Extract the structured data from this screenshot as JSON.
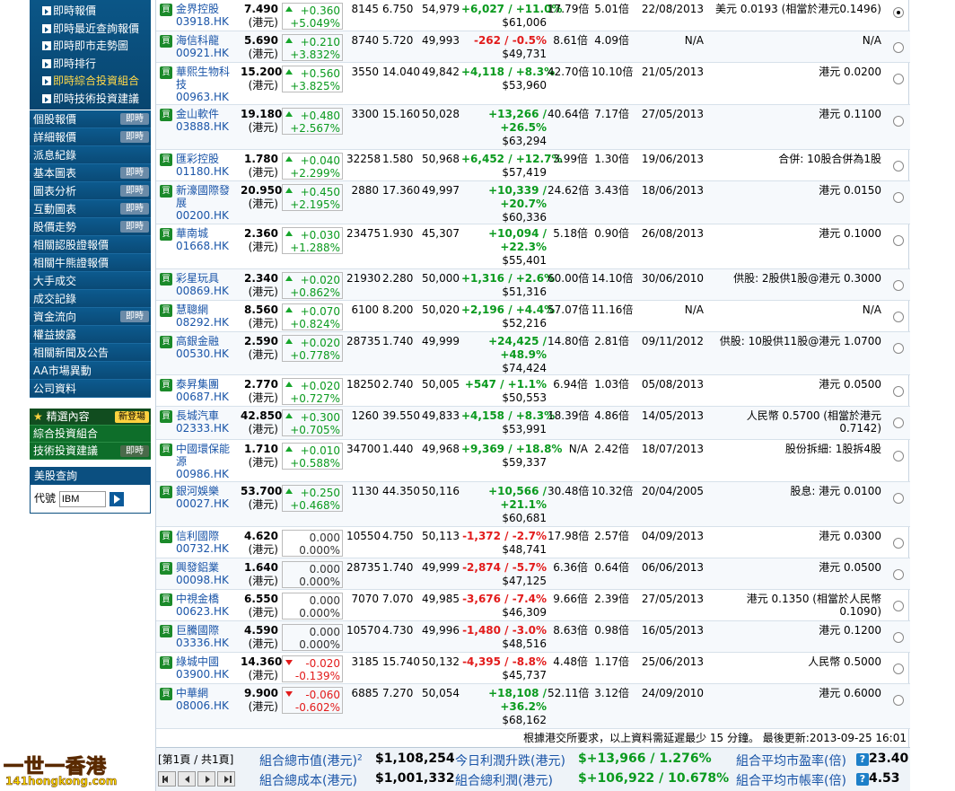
{
  "sidebar": {
    "sub_items": [
      "即時報價",
      "即時最近查詢報價",
      "即時即市走勢圖",
      "即時排行",
      "即時綜合投資組合",
      "即時技術投資建議"
    ],
    "menu": [
      {
        "label": "個股報價",
        "badge": "即時"
      },
      {
        "label": "詳細報價",
        "badge": "即時"
      },
      {
        "label": "派息紀錄",
        "badge": ""
      },
      {
        "label": "基本圖表",
        "badge": "即時"
      },
      {
        "label": "圖表分析",
        "badge": "即時"
      },
      {
        "label": "互動圖表",
        "badge": "即時"
      },
      {
        "label": "股價走勢",
        "badge": "即時"
      },
      {
        "label": "相關認股證報價",
        "badge": ""
      },
      {
        "label": "相關牛熊證報價",
        "badge": ""
      },
      {
        "label": "大手成交",
        "badge": ""
      },
      {
        "label": "成交記錄",
        "badge": ""
      },
      {
        "label": "資金流向",
        "badge": "即時"
      },
      {
        "label": "權益披露",
        "badge": ""
      },
      {
        "label": "相關新聞及公告",
        "badge": ""
      },
      {
        "label": "AA市場異動",
        "badge": ""
      },
      {
        "label": "公司資料",
        "badge": ""
      }
    ],
    "green": {
      "head": "精選內容",
      "new_badge": "新登場",
      "items": [
        {
          "label": "綜合投資組合",
          "badge": ""
        },
        {
          "label": "技術投資建議",
          "badge": "即時"
        }
      ]
    },
    "us": {
      "title": "美股查詢",
      "code_label": "代號",
      "code_value": "IBM"
    }
  },
  "buy_label": "買",
  "unit_label": "(港元)",
  "rows": [
    {
      "name": "金界控股",
      "code": "03918.HK",
      "price": "7.490",
      "chg": "+0.360",
      "pct": "+5.049%",
      "dir": "up",
      "lot": "8145",
      "cost": "6.750",
      "value": "54,979",
      "pl": "+6,027 / +11.0%",
      "pl2": "",
      "mv": "$61,006",
      "pe": "17.79倍",
      "pb": "5.01倍",
      "date": "22/08/2013",
      "dividend": "美元 0.0193 (相當於港元0.1496)",
      "selected": true
    },
    {
      "name": "海信科龍",
      "code": "00921.HK",
      "price": "5.690",
      "chg": "+0.210",
      "pct": "+3.832%",
      "dir": "up",
      "lot": "8740",
      "cost": "5.720",
      "value": "49,993",
      "pl": "-262 / -0.5%",
      "pl2": "",
      "mv": "$49,731",
      "pe": "8.61倍",
      "pb": "4.09倍",
      "date": "N/A",
      "dividend": "N/A",
      "selected": false
    },
    {
      "name": "華熙生物科技",
      "code": "00963.HK",
      "price": "15.200",
      "chg": "+0.560",
      "pct": "+3.825%",
      "dir": "up",
      "lot": "3550",
      "cost": "14.040",
      "value": "49,842",
      "pl": "+4,118 / +8.3%",
      "pl2": "",
      "mv": "$53,960",
      "pe": "42.70倍",
      "pb": "10.10倍",
      "date": "21/05/2013",
      "dividend": "港元 0.0200",
      "selected": false
    },
    {
      "name": "金山軟件",
      "code": "03888.HK",
      "price": "19.180",
      "chg": "+0.480",
      "pct": "+2.567%",
      "dir": "up",
      "lot": "3300",
      "cost": "15.160",
      "value": "50,028",
      "pl": "+13,266 /",
      "pl2": "+26.5%",
      "mv": "$63,294",
      "pe": "40.64倍",
      "pb": "7.17倍",
      "date": "27/05/2013",
      "dividend": "港元 0.1100",
      "selected": false
    },
    {
      "name": "匯彩控股",
      "code": "01180.HK",
      "price": "1.780",
      "chg": "+0.040",
      "pct": "+2.299%",
      "dir": "up",
      "lot": "32258",
      "cost": "1.580",
      "value": "50,968",
      "pl": "+6,452 / +12.7%",
      "pl2": "",
      "mv": "$57,419",
      "pe": "3.99倍",
      "pb": "1.30倍",
      "date": "19/06/2013",
      "dividend": "合併: 10股合併為1股",
      "selected": false
    },
    {
      "name": "新濠國際發展",
      "code": "00200.HK",
      "price": "20.950",
      "chg": "+0.450",
      "pct": "+2.195%",
      "dir": "up",
      "lot": "2880",
      "cost": "17.360",
      "value": "49,997",
      "pl": "+10,339 /",
      "pl2": "+20.7%",
      "mv": "$60,336",
      "pe": "24.62倍",
      "pb": "3.43倍",
      "date": "18/06/2013",
      "dividend": "港元 0.0150",
      "selected": false
    },
    {
      "name": "華南城",
      "code": "01668.HK",
      "price": "2.360",
      "chg": "+0.030",
      "pct": "+1.288%",
      "dir": "up",
      "lot": "23475",
      "cost": "1.930",
      "value": "45,307",
      "pl": "+10,094 /",
      "pl2": "+22.3%",
      "mv": "$55,401",
      "pe": "5.18倍",
      "pb": "0.90倍",
      "date": "26/08/2013",
      "dividend": "港元 0.1000",
      "selected": false
    },
    {
      "name": "彩星玩具",
      "code": "00869.HK",
      "price": "2.340",
      "chg": "+0.020",
      "pct": "+0.862%",
      "dir": "up",
      "lot": "21930",
      "cost": "2.280",
      "value": "50,000",
      "pl": "+1,316 / +2.6%",
      "pl2": "",
      "mv": "$51,316",
      "pe": "60.00倍",
      "pb": "14.10倍",
      "date": "30/06/2010",
      "dividend": "供股: 2股供1股@港元 0.3000",
      "selected": false
    },
    {
      "name": "慧聰網",
      "code": "08292.HK",
      "price": "8.560",
      "chg": "+0.070",
      "pct": "+0.824%",
      "dir": "up",
      "lot": "6100",
      "cost": "8.200",
      "value": "50,020",
      "pl": "+2,196 / +4.4%",
      "pl2": "",
      "mv": "$52,216",
      "pe": "57.07倍",
      "pb": "11.16倍",
      "date": "N/A",
      "dividend": "N/A",
      "selected": false
    },
    {
      "name": "高銀金融",
      "code": "00530.HK",
      "price": "2.590",
      "chg": "+0.020",
      "pct": "+0.778%",
      "dir": "up",
      "lot": "28735",
      "cost": "1.740",
      "value": "49,999",
      "pl": "+24,425 /",
      "pl2": "+48.9%",
      "mv": "$74,424",
      "pe": "14.80倍",
      "pb": "2.81倍",
      "date": "09/11/2012",
      "dividend": "供股: 10股供11股@港元 1.0700",
      "selected": false
    },
    {
      "name": "泰昇集團",
      "code": "00687.HK",
      "price": "2.770",
      "chg": "+0.020",
      "pct": "+0.727%",
      "dir": "up",
      "lot": "18250",
      "cost": "2.740",
      "value": "50,005",
      "pl": "+547 / +1.1%",
      "pl2": "",
      "mv": "$50,553",
      "pe": "6.94倍",
      "pb": "1.03倍",
      "date": "05/08/2013",
      "dividend": "港元 0.0500",
      "selected": false
    },
    {
      "name": "長城汽車",
      "code": "02333.HK",
      "price": "42.850",
      "chg": "+0.300",
      "pct": "+0.705%",
      "dir": "up",
      "lot": "1260",
      "cost": "39.550",
      "value": "49,833",
      "pl": "+4,158 / +8.3%",
      "pl2": "",
      "mv": "$53,991",
      "pe": "18.39倍",
      "pb": "4.86倍",
      "date": "14/05/2013",
      "dividend": "人民幣 0.5700 (相當於港元 0.7142)",
      "selected": false
    },
    {
      "name": "中國環保能源",
      "code": "00986.HK",
      "price": "1.710",
      "chg": "+0.010",
      "pct": "+0.588%",
      "dir": "up",
      "lot": "34700",
      "cost": "1.440",
      "value": "49,968",
      "pl": "+9,369 / +18.8%",
      "pl2": "",
      "mv": "$59,337",
      "pe": "N/A",
      "pb": "2.42倍",
      "date": "18/07/2013",
      "dividend": "股份拆細: 1股拆4股",
      "selected": false
    },
    {
      "name": "銀河娛樂",
      "code": "00027.HK",
      "price": "53.700",
      "chg": "+0.250",
      "pct": "+0.468%",
      "dir": "up",
      "lot": "1130",
      "cost": "44.350",
      "value": "50,116",
      "pl": "+10,566 /",
      "pl2": "+21.1%",
      "mv": "$60,681",
      "pe": "30.48倍",
      "pb": "10.32倍",
      "date": "20/04/2005",
      "dividend": "股息: 港元 0.0100",
      "selected": false
    },
    {
      "name": "信利國際",
      "code": "00732.HK",
      "price": "4.620",
      "chg": "0.000",
      "pct": "0.000%",
      "dir": "flat",
      "lot": "10550",
      "cost": "4.750",
      "value": "50,113",
      "pl": "-1,372 / -2.7%",
      "pl2": "",
      "mv": "$48,741",
      "pe": "17.98倍",
      "pb": "2.57倍",
      "date": "04/09/2013",
      "dividend": "港元 0.0300",
      "selected": false
    },
    {
      "name": "興發鋁業",
      "code": "00098.HK",
      "price": "1.640",
      "chg": "0.000",
      "pct": "0.000%",
      "dir": "flat",
      "lot": "28735",
      "cost": "1.740",
      "value": "49,999",
      "pl": "-2,874 / -5.7%",
      "pl2": "",
      "mv": "$47,125",
      "pe": "6.36倍",
      "pb": "0.64倍",
      "date": "06/06/2013",
      "dividend": "港元 0.0500",
      "selected": false
    },
    {
      "name": "中視金橋",
      "code": "00623.HK",
      "price": "6.550",
      "chg": "0.000",
      "pct": "0.000%",
      "dir": "flat",
      "lot": "7070",
      "cost": "7.070",
      "value": "49,985",
      "pl": "-3,676 / -7.4%",
      "pl2": "",
      "mv": "$46,309",
      "pe": "9.66倍",
      "pb": "2.39倍",
      "date": "27/05/2013",
      "dividend": "港元 0.1350 (相當於人民幣 0.1090)",
      "selected": false
    },
    {
      "name": "巨騰國際",
      "code": "03336.HK",
      "price": "4.590",
      "chg": "0.000",
      "pct": "0.000%",
      "dir": "flat",
      "lot": "10570",
      "cost": "4.730",
      "value": "49,996",
      "pl": "-1,480 / -3.0%",
      "pl2": "",
      "mv": "$48,516",
      "pe": "8.63倍",
      "pb": "0.98倍",
      "date": "16/05/2013",
      "dividend": "港元 0.1200",
      "selected": false
    },
    {
      "name": "綠城中國",
      "code": "03900.HK",
      "price": "14.360",
      "chg": "-0.020",
      "pct": "-0.139%",
      "dir": "down",
      "lot": "3185",
      "cost": "15.740",
      "value": "50,132",
      "pl": "-4,395 / -8.8%",
      "pl2": "",
      "mv": "$45,737",
      "pe": "4.48倍",
      "pb": "1.17倍",
      "date": "25/06/2013",
      "dividend": "人民幣 0.5000",
      "selected": false
    },
    {
      "name": "中華網",
      "code": "08006.HK",
      "price": "9.900",
      "chg": "-0.060",
      "pct": "-0.602%",
      "dir": "down",
      "lot": "6885",
      "cost": "7.270",
      "value": "50,054",
      "pl": "+18,108 /",
      "pl2": "+36.2%",
      "mv": "$68,162",
      "pe": "52.11倍",
      "pb": "3.12倍",
      "date": "24/09/2010",
      "dividend": "港元 0.6000",
      "selected": false
    }
  ],
  "note": "根據港交所要求，以上資料需延遲最少 15 分鐘。 最後更新:2013-09-25 16:01",
  "footer": {
    "page": "[第1頁 / 共1頁]",
    "market_value_label": "組合總市值(港元)",
    "market_value_sup": "2",
    "market_value": "$1,108,254",
    "cost_label": "組合總成本(港元)",
    "cost": "$1,001,332",
    "today_label": "今日利潤升跌(港元)",
    "today": "$+13,966 / 1.276%",
    "profit_label": "組合總利潤(港元)",
    "profit": "$+106,922 / 10.678%",
    "pe_label": "組合平均市盈率(倍)",
    "pe": "23.40",
    "pb_label": "組合平均市帳率(倍)",
    "pb": "4.53",
    "help": "?"
  },
  "logo": {
    "main": "一世一香港",
    "url": "141hongkong.com"
  },
  "colors": {
    "up": "#0a9a1e",
    "down": "#e21b1b",
    "link": "#1a55a8",
    "nav": "#0b4f80"
  }
}
